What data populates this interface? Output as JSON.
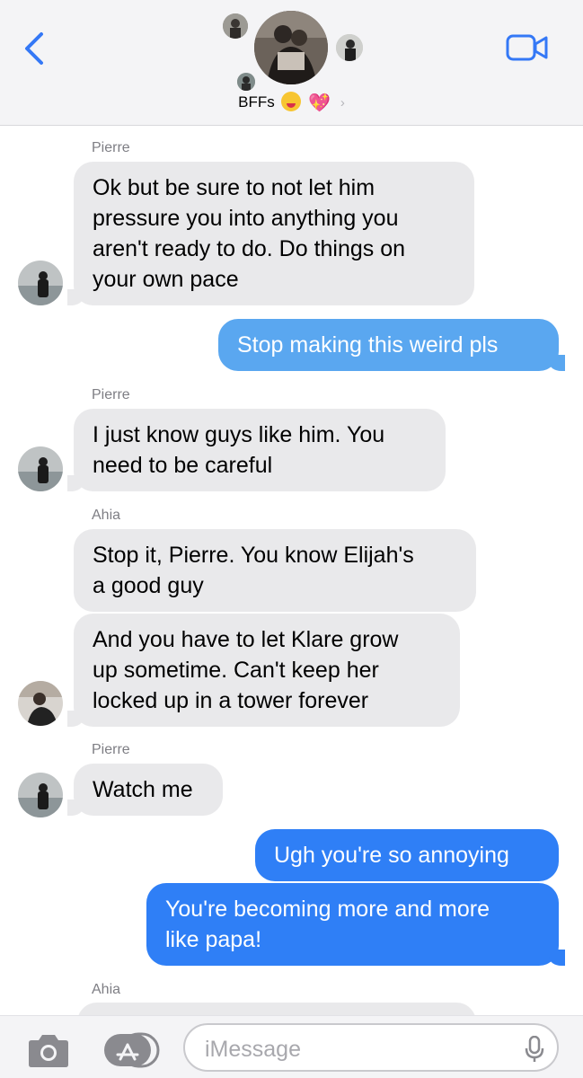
{
  "header": {
    "group_name": "BFFs",
    "heart_emoji": "💖",
    "chevron": "›"
  },
  "messages": [
    {
      "sender": "Pierre",
      "text": "Ok but be sure to not let him pressure you into anything you aren't ready to do. Do things on your own pace",
      "direction": "received"
    },
    {
      "text": "Stop making this weird pls",
      "direction": "sent"
    },
    {
      "sender": "Pierre",
      "text": "I just know guys like him. You need to be careful",
      "direction": "received"
    },
    {
      "sender": "Ahia",
      "text": "Stop it, Pierre. You know Elijah's a good guy",
      "direction": "received"
    },
    {
      "text": "And you have to let Klare grow up sometime. Can't keep her locked up in a tower forever",
      "direction": "received"
    },
    {
      "sender": "Pierre",
      "text": "Watch me",
      "direction": "received"
    },
    {
      "text": "Ugh you're so annoying",
      "direction": "sent"
    },
    {
      "text": "You're becoming more and more like papa!",
      "direction": "sent"
    },
    {
      "sender": "Ahia",
      "text": "",
      "direction": "received"
    }
  ],
  "message_lines": {
    "m0": [
      "Ok but be sure to not let him",
      "pressure you into anything you",
      "aren't ready to do. Do things on",
      "your own pace"
    ],
    "m2": [
      "I just know guys like him. You",
      "need to be careful"
    ],
    "m3": [
      "Stop it, Pierre. You know Elijah's",
      "a good guy"
    ],
    "m4": [
      "And you have to let Klare grow",
      "up sometime. Can't keep her",
      "locked up in a tower forever"
    ],
    "m7": [
      "You're becoming more and more",
      "like papa!"
    ]
  },
  "composer": {
    "placeholder": "iMessage"
  },
  "colors": {
    "received_bubble": "#e9e9eb",
    "sent_bubble_light": "#5aa7f0",
    "sent_bubble_dark": "#2f7ff6",
    "accent": "#3478f6"
  },
  "icons": {
    "back": "chevron-left-icon",
    "video": "video-camera-icon",
    "camera": "camera-icon",
    "apps": "app-store-icon",
    "mic": "microphone-icon"
  }
}
